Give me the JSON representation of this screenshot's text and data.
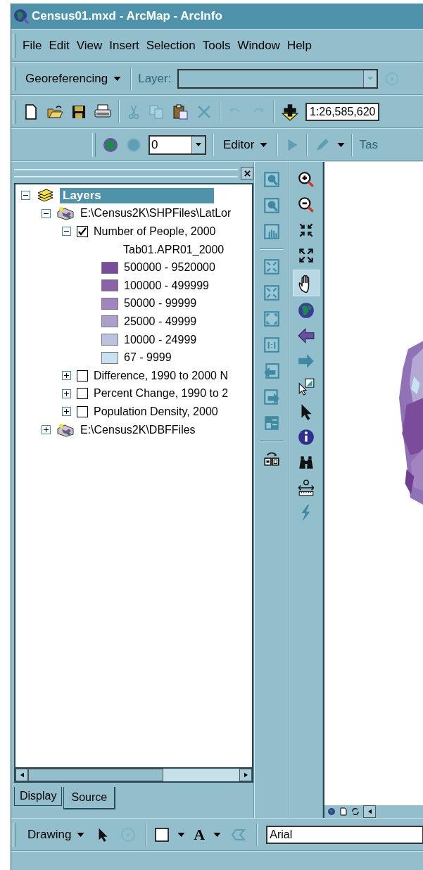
{
  "window": {
    "title": "Census01.mxd - ArcMap - ArcInfo"
  },
  "menu": [
    "File",
    "Edit",
    "View",
    "Insert",
    "Selection",
    "Tools",
    "Window",
    "Help"
  ],
  "georeferencing_toolbar": {
    "menu": "Georeferencing",
    "layer_label": "Layer:"
  },
  "standard_toolbar": {
    "scale": "1:26,585,620"
  },
  "editor_toolbar": {
    "value": "0",
    "editor_menu": "Editor",
    "task_label": "Tas"
  },
  "toc": {
    "tree": [
      {
        "label": "Layers",
        "kind": "dataframe",
        "expanded": true,
        "selected": true,
        "children": [
          {
            "label": "E:\\Census2K\\SHPFiles\\LatLor",
            "kind": "group",
            "expanded": true,
            "children": [
              {
                "label": "Number of People, 2000",
                "kind": "layer",
                "checked": true,
                "expanded": true,
                "legend": {
                  "field": "Tab01.APR01_2000",
                  "classes": [
                    {
                      "label": "500000 - 9520000",
                      "color": "#7b4b9c"
                    },
                    {
                      "label": "100000 - 499999",
                      "color": "#8c62ab"
                    },
                    {
                      "label": "50000 - 99999",
                      "color": "#a184c0"
                    },
                    {
                      "label": "25000 - 49999",
                      "color": "#ad9fcd"
                    },
                    {
                      "label": "10000 - 24999",
                      "color": "#bcc2df"
                    },
                    {
                      "label": "67 - 9999",
                      "color": "#c8e2f2"
                    }
                  ]
                }
              },
              {
                "label": "Difference, 1990 to 2000 N",
                "kind": "layer",
                "checked": false,
                "expanded": false
              },
              {
                "label": "Percent Change, 1990 to 2",
                "kind": "layer",
                "checked": false,
                "expanded": false
              },
              {
                "label": "Population Density, 2000",
                "kind": "layer",
                "checked": false,
                "expanded": false
              }
            ]
          },
          {
            "label": "E:\\Census2K\\DBFFiles",
            "kind": "group",
            "expanded": false
          }
        ]
      }
    ],
    "tabs": [
      {
        "label": "Display",
        "selected": false
      },
      {
        "label": "Source",
        "selected": true
      }
    ]
  },
  "map_tools": [
    {
      "selected": false
    },
    {
      "selected": false
    },
    {
      "selected": false
    },
    {
      "selected": false
    },
    {
      "selected": true
    },
    {
      "selected": false
    },
    {
      "selected": false
    },
    {
      "selected": false
    },
    {
      "selected": false
    },
    {
      "selected": false
    },
    {
      "selected": false
    },
    {
      "selected": false
    },
    {
      "selected": false
    },
    {
      "selected": false
    }
  ],
  "drawing_toolbar": {
    "menu": "Drawing",
    "font_color_glyph": "A",
    "font": "Arial"
  }
}
